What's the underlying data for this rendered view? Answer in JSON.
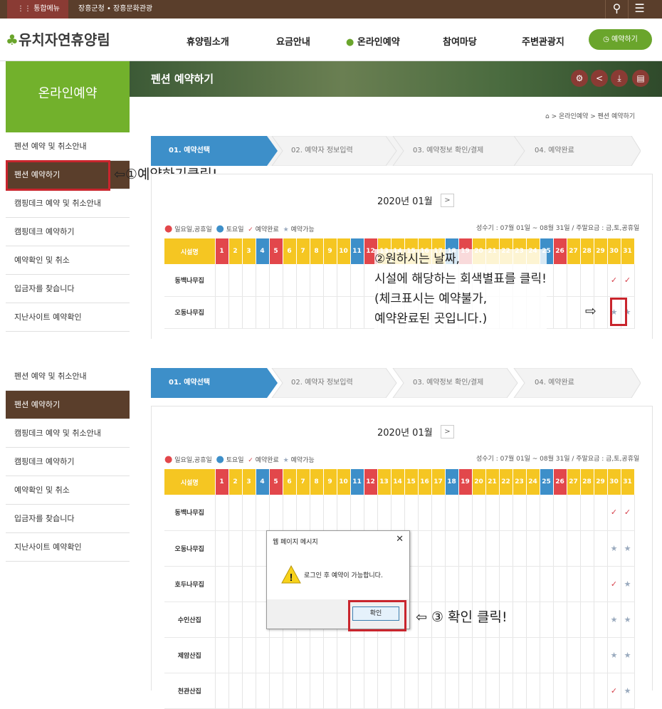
{
  "topbar": {
    "menu_all": "통합메뉴",
    "links": "장흥군청  •  장흥문화관광"
  },
  "header": {
    "logo": "유치자연휴양림",
    "nav": [
      "휴양림소개",
      "요금안내",
      "온라인예약",
      "참여마당",
      "주변관광지"
    ],
    "reserve_btn": "예약하기"
  },
  "side_title": "온라인예약",
  "banner_title": "펜션 예약하기",
  "breadcrumb": "> 온라인예약 > 펜션 예약하기",
  "side_menu": [
    "펜션 예약 및 취소안내",
    "펜션 예약하기",
    "캠핑데크 예약 및 취소안내",
    "캠핑데크 예약하기",
    "예약확인 및 취소",
    "입금자를 찾습니다",
    "지난사이트 예약확인"
  ],
  "steps": [
    "01. 예약선택",
    "02. 예약자 정보입력",
    "03. 예약정보 확인/결제",
    "04. 예약완료"
  ],
  "calendar": {
    "month": "2020년 01월",
    "next": ">",
    "legend": [
      "일요일,공휴일",
      "토요일",
      "예약완료",
      "예약가능"
    ],
    "season": "성수기 : 07월 01일 ~ 08월 31일 / 주말요금 : 금,토,공휴일",
    "header_first": "시설명",
    "days": [
      "1",
      "2",
      "3",
      "4",
      "5",
      "6",
      "7",
      "8",
      "9",
      "10",
      "11",
      "12",
      "13",
      "14",
      "15",
      "16",
      "17",
      "18",
      "19",
      "20",
      "21",
      "22",
      "23",
      "24",
      "25",
      "26",
      "27",
      "28",
      "29",
      "30",
      "31"
    ],
    "facilities_top": [
      "동백나무집",
      "오동나무집"
    ],
    "facilities_bottom": [
      "동백나무집",
      "오동나무집",
      "호두나무집",
      "수인산집",
      "제암산집",
      "천관산집"
    ]
  },
  "dialog": {
    "title": "웹 페이지 메시지",
    "message": "로그인 후 예약이 가능합니다.",
    "ok": "확인"
  },
  "annotations": {
    "a1": "①예약하기클릭!",
    "a2": [
      "②원하시는 날짜,",
      "시설에 해당하는 회색별표를 클릭!",
      "(체크표시는 예약불가,",
      "예약완료된 곳입니다.)"
    ],
    "a3": "③ 확인 클릭!"
  },
  "colors": {
    "brown": "#5a3e2b",
    "green": "#72b12c",
    "blue": "#3d8fc9",
    "yellow": "#f5c622",
    "red": "#e2474b"
  }
}
